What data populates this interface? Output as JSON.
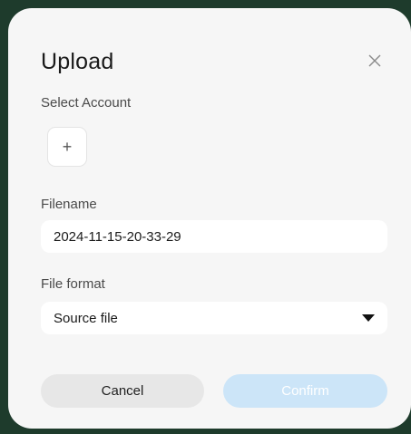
{
  "dialog": {
    "title": "Upload",
    "account_label": "Select Account",
    "add_account_symbol": "+",
    "filename_label": "Filename",
    "filename_value": "2024-11-15-20-33-29",
    "format_label": "File format",
    "format_selected": "Source file",
    "cancel_label": "Cancel",
    "confirm_label": "Confirm"
  },
  "icons": {
    "close": "close-icon",
    "dropdown": "triangle-down-icon",
    "add": "plus-icon"
  },
  "colors": {
    "dialog_background": "#f6f6f6",
    "confirm_disabled": "#cce5f8",
    "cancel_background": "#e7e7e7"
  }
}
